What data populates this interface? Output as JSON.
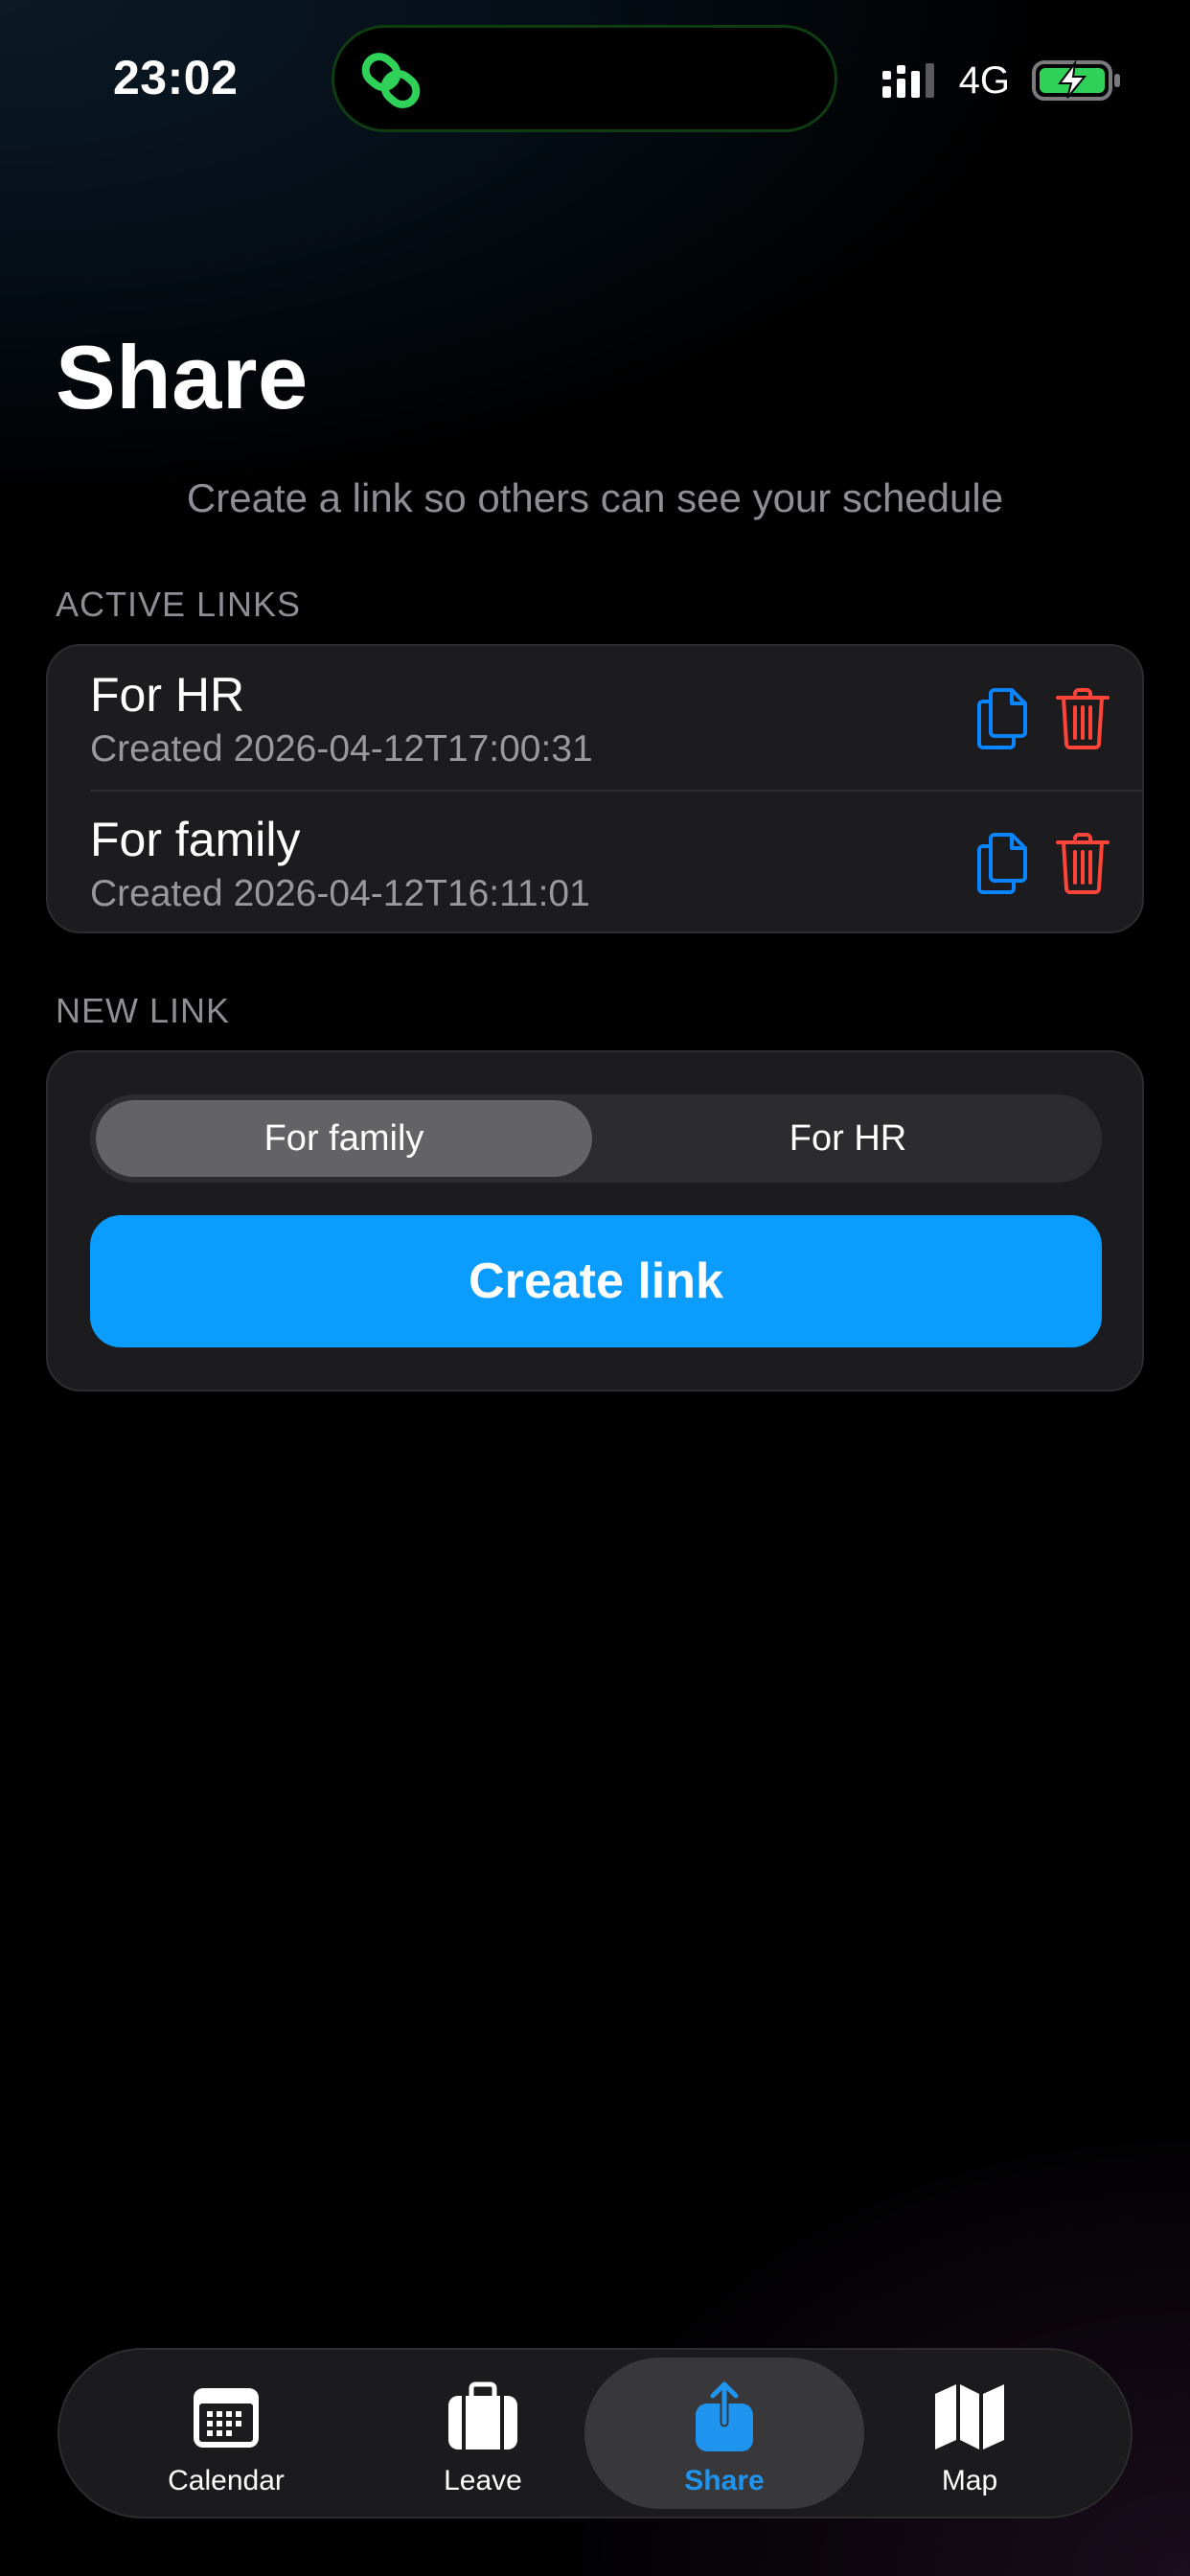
{
  "status_bar": {
    "time": "23:02",
    "network": "4G",
    "battery_state": "charging"
  },
  "page": {
    "title": "Share",
    "subtitle": "Create a link so others can see your schedule"
  },
  "active_links": {
    "section_label": "ACTIVE LINKS",
    "items": [
      {
        "name": "For HR",
        "created": "Created 2026-04-12T17:00:31"
      },
      {
        "name": "For family",
        "created": "Created 2026-04-12T16:11:01"
      }
    ]
  },
  "new_link": {
    "section_label": "NEW LINK",
    "segments": [
      {
        "label": "For family",
        "selected": true
      },
      {
        "label": "For HR",
        "selected": false
      }
    ],
    "create_label": "Create link"
  },
  "tab_bar": {
    "tabs": [
      {
        "label": "Calendar",
        "icon": "calendar-icon",
        "active": false
      },
      {
        "label": "Leave",
        "icon": "briefcase-icon",
        "active": false
      },
      {
        "label": "Share",
        "icon": "share-icon",
        "active": true
      },
      {
        "label": "Map",
        "icon": "map-icon",
        "active": false
      }
    ]
  },
  "colors": {
    "accent": "#0a9cff",
    "tab_active": "#1f94ee",
    "destructive": "#ff453a",
    "island_glow": "#30d158",
    "battery_charge": "#30d158"
  }
}
